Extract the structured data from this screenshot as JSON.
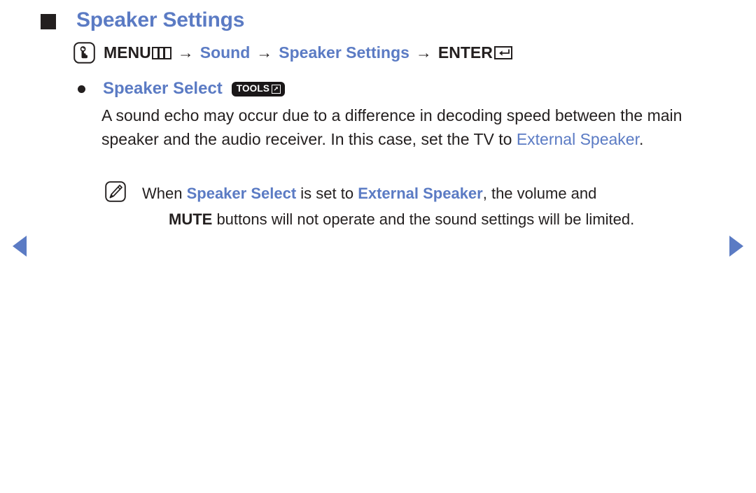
{
  "page": {
    "accent_color": "#5b7bc4",
    "text_color": "#231f1f",
    "background": "#ffffff"
  },
  "section": {
    "bullet_icon": "black-square-bullet",
    "title": "Speaker Settings"
  },
  "menu_path": {
    "touch_icon": "menu-touch-icon",
    "menu_label": "MENU",
    "menu_glyph": "menu-bars-glyph",
    "arrow": "→",
    "steps": [
      {
        "label": "Sound",
        "style": "blue"
      },
      {
        "label": "Speaker Settings",
        "style": "blue"
      }
    ],
    "enter_label": "ENTER",
    "enter_glyph": "enter-return-glyph"
  },
  "bullet_item": {
    "dot_icon": "round-bullet",
    "label": "Speaker Select",
    "badge": {
      "text": "TOOLS",
      "icon": "tools-arrow-icon"
    }
  },
  "body": {
    "part1": "A sound echo may occur due to a difference in decoding speed between the main speaker and the audio receiver. In this case, set the TV to ",
    "highlight1": "External Speaker",
    "part2": "."
  },
  "note": {
    "icon": "note-pencil-icon",
    "line1_a": "When ",
    "line1_hl1": "Speaker Select",
    "line1_b": " is set to ",
    "line1_hl2": "External Speaker",
    "line1_c": ", the volume and",
    "line2_bold": "MUTE",
    "line2_rest": " buttons will not operate and the sound settings will be limited."
  },
  "nav": {
    "prev_label": "previous-page",
    "next_label": "next-page"
  }
}
